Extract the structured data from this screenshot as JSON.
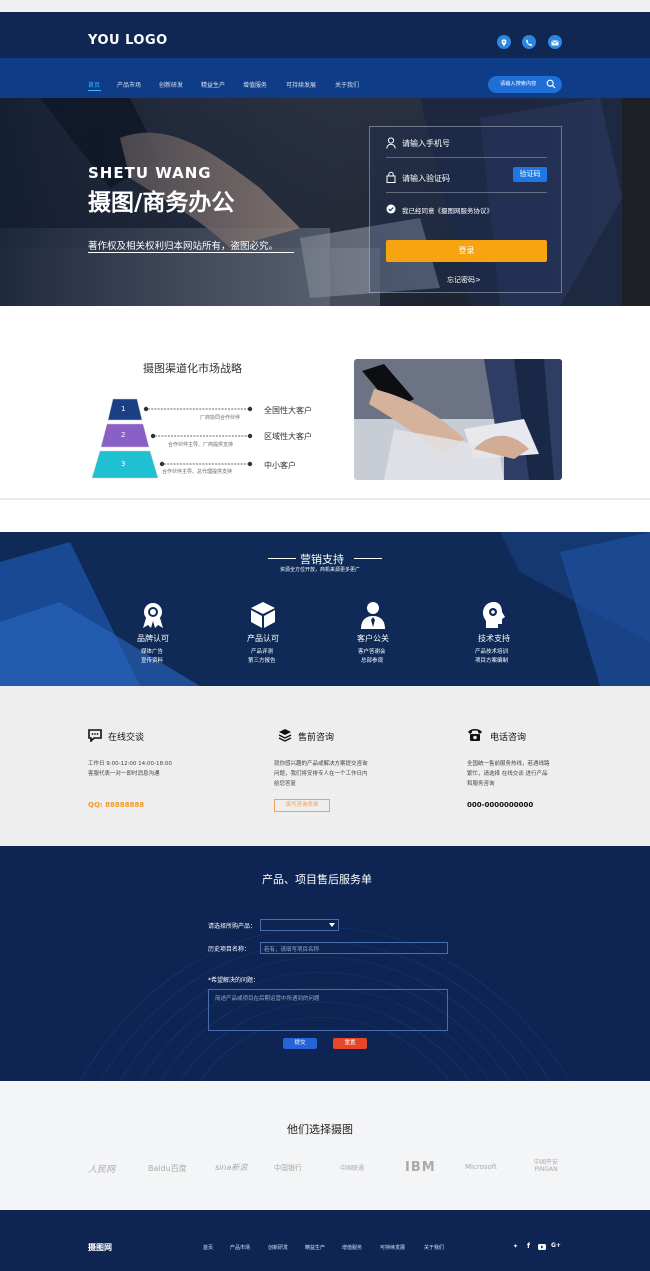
{
  "header": {
    "logo": "YOU LOGO",
    "icons": [
      "location-icon",
      "phone-icon",
      "mail-icon"
    ]
  },
  "nav": {
    "items": [
      "首页",
      "产品市场",
      "创新研发",
      "精益生产",
      "增值服务",
      "可持续发展",
      "关于我们"
    ],
    "search_placeholder": "请输入搜索内容"
  },
  "hero": {
    "subtitle": "SHETU WANG",
    "title": "摄图/商务办公",
    "copyright": "著作权及相关权利归本网站所有，盗图必究。"
  },
  "login": {
    "phone_placeholder": "请输入手机号",
    "code_placeholder": "请输入验证码",
    "code_button": "验证码",
    "agree": "我已经同意《摄图网服务协议》",
    "submit": "登录",
    "forgot": "忘记密码>"
  },
  "strategy": {
    "title": "摄图渠道化市场战略",
    "levels": [
      {
        "num": "1",
        "label": "全国性大客户",
        "note": "厂商协同合作伙伴",
        "color": "#1a3f85"
      },
      {
        "num": "2",
        "label": "区域性大客户",
        "note": "合作伙伴主导、厂商提供支持",
        "color": "#8a5fc6"
      },
      {
        "num": "3",
        "label": "中小客户",
        "note": "合作伙伴主导、总代理提供支持",
        "color": "#1fc0d2"
      }
    ]
  },
  "marketing": {
    "title": "营销支持",
    "subtitle": "资源全方位开放，商机来源更多更广",
    "items": [
      {
        "icon": "award-icon",
        "title": "品牌认可",
        "lines": [
          "媒体广告",
          "宣传资料"
        ]
      },
      {
        "icon": "cube-icon",
        "title": "产品认可",
        "lines": [
          "产品评测",
          "第三方报告"
        ]
      },
      {
        "icon": "user-tie-icon",
        "title": "客户公关",
        "lines": [
          "客户答谢会",
          "总部参观"
        ]
      },
      {
        "icon": "head-gear-icon",
        "title": "技术支持",
        "lines": [
          "产品技术培训",
          "项目方案编制"
        ]
      }
    ]
  },
  "contact": {
    "online": {
      "title": "在线交谈",
      "text1": "工作日 9:00-12:00 14:00-18:00",
      "text2": "客服代表一对一即时消息沟通",
      "qq": "QQ: 88888888"
    },
    "presale": {
      "title": "售前咨询",
      "text1": "就你感兴趣的产品或解决方案提交咨询",
      "text2": "问题，我们将安排专人在一个工作日内",
      "text3": "给您答复",
      "button": "填写咨询表单"
    },
    "phone": {
      "title": "电话咨询",
      "text1": "全国统一售前服务热线，若遇线路",
      "text2": "繁忙，请选择 在线交谈 进行产品",
      "text3": "和服务咨询",
      "number": "000-0000000000"
    }
  },
  "form": {
    "title": "产品、项目售后服务单",
    "product_label": "请选择所购产品：",
    "history_label": "历史项目名称：",
    "history_placeholder": "若有，请填写项目名称",
    "issue_label": "*希望解决的问题：",
    "issue_placeholder": "简述产品或项目在后期运营中所遇到的问题",
    "submit": "提交",
    "reset": "重置"
  },
  "clients": {
    "title": "他们选择摄图",
    "logos": [
      "人民网",
      "Baidu百度",
      "sina新浪",
      "中国银行",
      "中国联通",
      "IBM",
      "Microsoft",
      "中国平安 PINGAN"
    ]
  },
  "footer": {
    "logo": "摄图网",
    "links": [
      "首页",
      "产品市场",
      "创新研发",
      "精益生产",
      "增值服务",
      "可持续发展",
      "关于我们"
    ],
    "social": [
      "twitter-icon",
      "facebook-icon",
      "youtube-icon",
      "google-plus-icon"
    ]
  }
}
